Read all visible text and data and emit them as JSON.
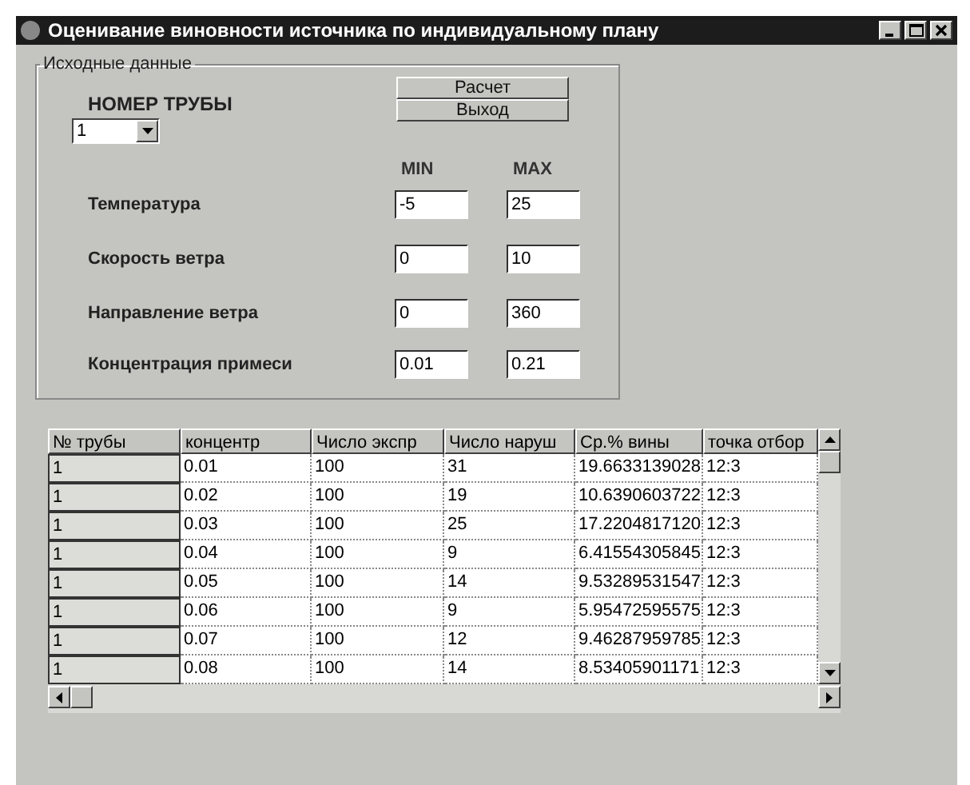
{
  "window": {
    "title": "Оценивание виновности источника по индивидуальному плану"
  },
  "group": {
    "label": "Исходные данные"
  },
  "pipe": {
    "label": "НОМЕР ТРУБЫ",
    "value": "1"
  },
  "buttons": [
    "Расчет",
    "Выход"
  ],
  "range_headers": {
    "min": "MIN",
    "max": "MAX"
  },
  "params": [
    {
      "label": "Температура",
      "min": "-5",
      "max": "25"
    },
    {
      "label": "Скорость ветра",
      "min": "0",
      "max": "10"
    },
    {
      "label": "Направление ветра",
      "min": "0",
      "max": "360"
    },
    {
      "label": "Концентрация примеси",
      "min": "0.01",
      "max": "0.21"
    }
  ],
  "table": {
    "columns": [
      "№ трубы",
      "концентр",
      "Число экспр",
      "Число наруш",
      "Ср.% вины",
      "точка отбор"
    ],
    "rows": [
      [
        "1",
        "0.01",
        "100",
        "31",
        "19.6633139028",
        "12:3"
      ],
      [
        "1",
        "0.02",
        "100",
        "19",
        "10.6390603722",
        "12:3"
      ],
      [
        "1",
        "0.03",
        "100",
        "25",
        "17.2204817120",
        "12:3"
      ],
      [
        "1",
        "0.04",
        "100",
        "9",
        "6.41554305845",
        "12:3"
      ],
      [
        "1",
        "0.05",
        "100",
        "14",
        "9.53289531547",
        "12:3"
      ],
      [
        "1",
        "0.06",
        "100",
        "9",
        "5.95472595575",
        "12:3"
      ],
      [
        "1",
        "0.07",
        "100",
        "12",
        "9.46287959785",
        "12:3"
      ],
      [
        "1",
        "0.08",
        "100",
        "14",
        "8.53405901171",
        "12:3"
      ]
    ]
  }
}
